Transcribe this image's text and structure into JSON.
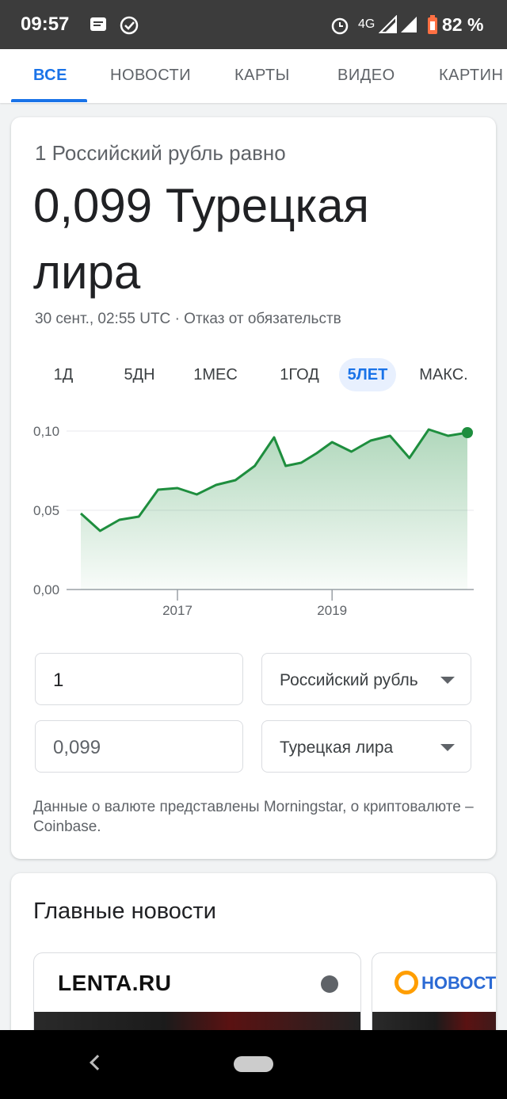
{
  "status": {
    "time": "09:57",
    "network": "4G",
    "battery": "82 %"
  },
  "tabs": [
    "ВСЕ",
    "НОВОСТИ",
    "КАРТЫ",
    "ВИДЕО",
    "КАРТИН"
  ],
  "converter": {
    "equals_label": "1 Российский рубль равно",
    "result": "0,099 Турецкая лира",
    "timestamp": "30 сент., 02:55 UTC",
    "separator": "·",
    "disclaimer_link": "Отказ от обязательств",
    "ranges": [
      "1Д",
      "5ДН",
      "1МЕС",
      "1ГОД",
      "5ЛЕТ",
      "МАКС."
    ],
    "active_range": "5ЛЕТ",
    "from_amount": "1",
    "from_currency": "Российский рубль",
    "to_amount": "0,099",
    "to_currency": "Турецкая лира",
    "source_note": "Данные о валюте представлены Morningstar, о криптовалюте – Coinbase."
  },
  "chart_data": {
    "type": "area",
    "x": [
      2015.75,
      2016.0,
      2016.25,
      2016.5,
      2016.75,
      2017.0,
      2017.25,
      2017.5,
      2017.75,
      2018.0,
      2018.25,
      2018.4,
      2018.6,
      2018.8,
      2019.0,
      2019.25,
      2019.5,
      2019.75,
      2020.0,
      2020.25,
      2020.5,
      2020.75
    ],
    "y": [
      0.048,
      0.037,
      0.044,
      0.046,
      0.063,
      0.064,
      0.06,
      0.066,
      0.069,
      0.078,
      0.096,
      0.078,
      0.08,
      0.086,
      0.093,
      0.087,
      0.094,
      0.097,
      0.083,
      0.101,
      0.097,
      0.099
    ],
    "ylim": [
      0,
      0.1
    ],
    "yticks": [
      "0,00",
      "0,05",
      "0,10"
    ],
    "xticks": [
      "2017",
      "2019"
    ],
    "xtick_values": [
      2017,
      2019
    ],
    "color": "#1e8e3e",
    "grid": true
  },
  "news": {
    "title": "Главные новости",
    "sources": [
      "LENTA.RU",
      "НОВОСТИ"
    ]
  },
  "colors": {
    "accent": "#1a73e8",
    "chart_line": "#1e8e3e"
  }
}
